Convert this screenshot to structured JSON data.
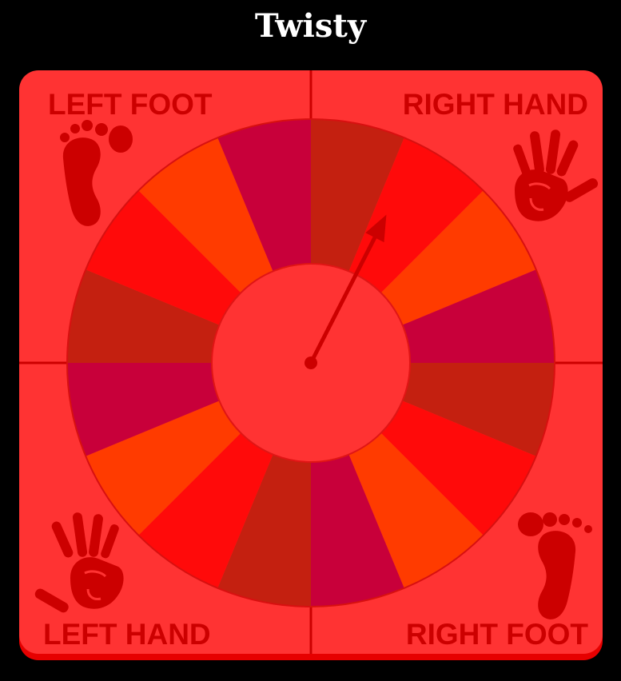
{
  "app": {
    "title": "Twisty"
  },
  "board": {
    "quadrants": {
      "top_left": {
        "label": "LEFT FOOT",
        "icon": "foot-icon"
      },
      "top_right": {
        "label": "RIGHT HAND",
        "icon": "hand-icon"
      },
      "bottom_left": {
        "label": "LEFT HAND",
        "icon": "hand-icon"
      },
      "bottom_right": {
        "label": "RIGHT FOOT",
        "icon": "foot-icon"
      }
    }
  },
  "spinner": {
    "segment_count": 16,
    "segment_colors": [
      "#c42010",
      "#ff0a0a",
      "#ff3b00",
      "#c8003a"
    ],
    "pointer_angle_deg": 27
  },
  "colors": {
    "page_background": "#000000",
    "board_background": "#ff3333",
    "board_shadow": "#e60000",
    "accent_dark": "#cc0000",
    "title_text": "#ffffff"
  }
}
